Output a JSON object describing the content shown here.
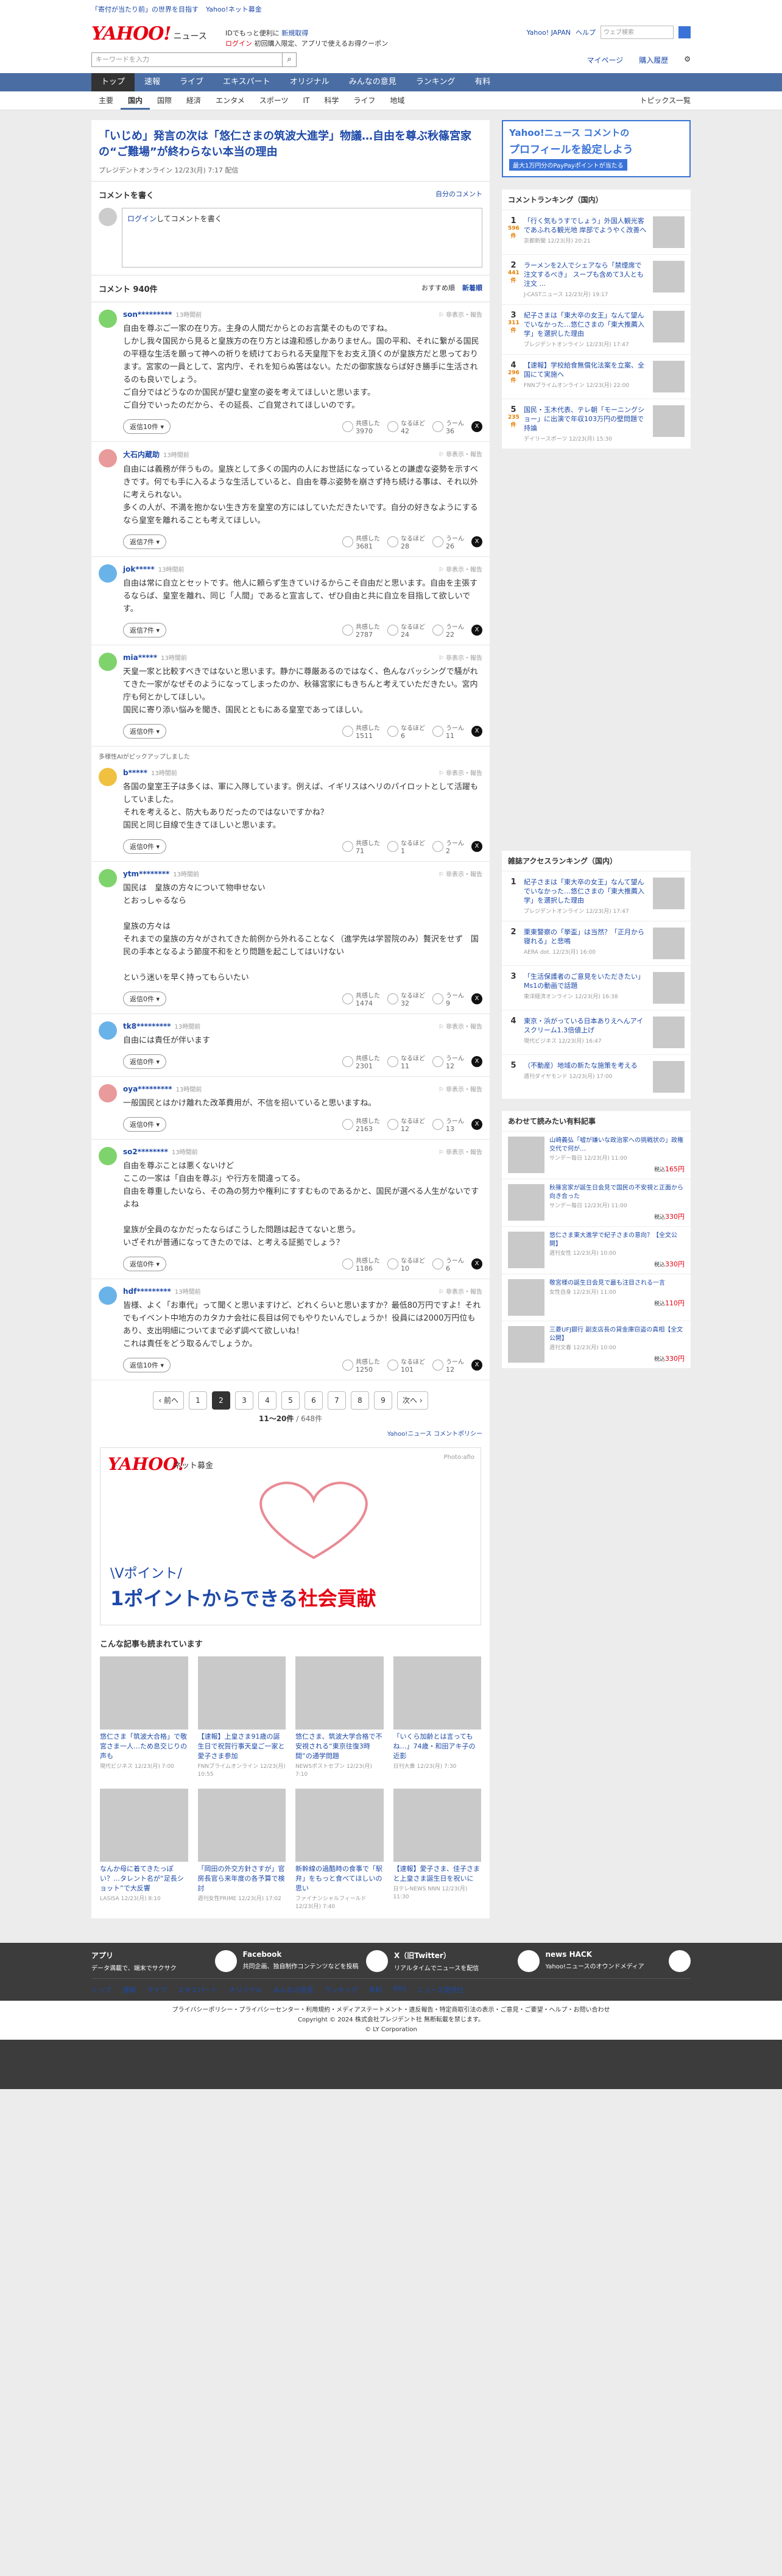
{
  "top_banner": [
    "「寄付が当たり前」の世界を目指す",
    "Yahoo!ネット募金"
  ],
  "header": {
    "logo": "YAHOO!",
    "logo_sub": "JAPAN",
    "title": "ニュース",
    "promo1": "IDでもっと便利に",
    "promo1_link": "新規取得",
    "promo2_link": "ログイン",
    "promo2": "初回購入限定、アプリで使えるお得クーポン",
    "links": [
      "Yahoo! JAPAN",
      "ヘルプ"
    ],
    "search_placeholder": "ウェブ検索",
    "search_btn": "検索",
    "news_search": "キーワードを入力",
    "mypage": "マイページ",
    "bought": "購入履歴"
  },
  "nav": [
    "トップ",
    "速報",
    "ライブ",
    "エキスパート",
    "オリジナル",
    "みんなの意見",
    "ランキング",
    "有料"
  ],
  "subnav": [
    "主要",
    "国内",
    "国際",
    "経済",
    "エンタメ",
    "スポーツ",
    "IT",
    "科学",
    "ライフ",
    "地域"
  ],
  "subnav_right": "トピックス一覧",
  "article": {
    "title": "「いじめ」発言の次は「悠仁さまの筑波大進学」物議…自由を尊ぶ秋篠宮家の“ご難場”が終わらない本当の理由",
    "meta": "プレジデントオンライン 12/23(月) 7:17 配信"
  },
  "comment_box": {
    "title": "コメントを書く",
    "link": "自分のコメント",
    "login": "ログイン",
    "placeholder": "してコメントを書く"
  },
  "comments_hd": {
    "title": "コメント 940件",
    "sort_recommend": "おすすめ順",
    "sort_new": "新着順"
  },
  "react_labels": [
    "共感した",
    "なるほど",
    "うーん"
  ],
  "reply": "返信",
  "report": "非表示・報告",
  "comments": [
    {
      "user": "son*********",
      "time": "13時間前",
      "text": "自由を尊ぶご一家の在り方。主身の人間だからとのお言葉そのものですね。\nしかし我々国民から見ると皇族方の在り方とは違和感しかありません。国の平和、それに繋がる国民の平穏な生活を願って神への祈りを続けておられる天皇陛下をお支え頂くのが皇族方だと思っております。宮家の一員として、宮内庁、それを知らぬ筈はない。ただの御家族ならば好き勝手に生活されるのも良いでしょう。\nご自分ではどうなのか国民が望む皇室の姿を考えてほしいと思います。\nご自分でいったのだから、その延長、ご自覚されてほしいのです。",
      "replies": "返信10件",
      "r": [
        3970,
        42,
        36
      ],
      "color": "#7fd36c"
    },
    {
      "user": "大石内蔵助",
      "time": "13時間前",
      "text": "自由には義務が伴うもの。皇族として多くの国内の人にお世話になっているとの謙虚な姿勢を示すべきです。何でも手に入るような生活していると、自由を尊ぶ姿勢を崩さず持ち続ける事は、それ以外に考えられない。\n多くの人が、不満を抱かない生き方を皇室の方にはしていただきたいです。自分の好きなようにするなら皇室を離れることも考えてほしい。",
      "replies": "返信7件",
      "r": [
        3681,
        28,
        26
      ],
      "color": "#e99a9a"
    },
    {
      "user": "jok*****",
      "time": "13時間前",
      "text": "自由は常に自立とセットです。他人に頼らず生きていけるからこそ自由だと思います。自由を主張するならば、皇室を離れ、同じ「人間」であると宣言して、ぜひ自由と共に自立を目指して欲しいです。",
      "replies": "返信7件",
      "r": [
        2787,
        24,
        22
      ],
      "color": "#6ab3e8"
    },
    {
      "user": "mia*****",
      "time": "13時間前",
      "text": "天皇一家と比較すべきではないと思います。静かに尊厳あるのではなく、色んなバッシングで騒がれてきた一家がなぜそのようになってしまったのか、秋篠宮家にもきちんと考えていただきたい。宮内庁も何とかしてほしい。\n国民に寄り添い悩みを聞き、国民とともにある皇室であってほしい。",
      "replies": "返信0件",
      "r": [
        1511,
        6,
        11
      ],
      "color": "#7fd36c"
    },
    {
      "pick": "多様性AIがピックアップしました",
      "user": "b*****",
      "time": "13時間前",
      "text": "各国の皇室王子は多くは、軍に入隊しています。例えば、イギリスはヘリのパイロットとして活躍もしていました。\nそれを考えると、防大もありだったのではないですかね？\n国民と同じ目線で生きてほしいと思います。",
      "replies": "返信0件",
      "r": [
        71,
        1,
        2
      ],
      "color": "#f0c040"
    },
    {
      "user": "ytm********",
      "time": "13時間前",
      "text": "国民は　皇族の方々について物申せない\nとおっしゃるなら\n\n皇族の方々は\nそれまでの皇族の方々がされてきた前例から外れることなく（進学先は学習院のみ）贅沢をせず　国民の手本となるよう節度不和をとり問題を起こしてはいけない\n\nという迷いを早く持ってもらいたい",
      "replies": "返信0件",
      "r": [
        1474,
        32,
        9
      ],
      "color": "#7fd36c"
    },
    {
      "user": "tk8*********",
      "time": "13時間前",
      "text": "自由には責任が伴います",
      "replies": "返信0件",
      "r": [
        2301,
        11,
        12
      ],
      "color": "#6ab3e8"
    },
    {
      "user": "oya*********",
      "time": "13時間前",
      "text": "一般国民とはかけ離れた改革費用が、不信を招いていると思いますね。",
      "replies": "返信0件",
      "r": [
        2163,
        12,
        13
      ],
      "color": "#e99a9a"
    },
    {
      "user": "so2********",
      "time": "13時間前",
      "text": "自由を尊ぶことは悪くないけど\nここの一家は「自由を尊ぶ」や行方を間違ってる。\n自由を尊重したいなら、その為の努力や権利にすすむものであるかと、国民が選べる人生がないですよね\n\n皇族が全員のなかだったならばこうした問題は起きてないと思う。\nいざそれが普通になってきたのでは、と考える証拠でしょう？",
      "replies": "返信0件",
      "r": [
        1186,
        10,
        6
      ],
      "color": "#7fd36c"
    },
    {
      "user": "hdf*********",
      "time": "13時間前",
      "text": "皆様、よく「お車代」って聞くと思いますけど、どれくらいと思いますか？最低80万円ですよ！それでもイベント中地方のカタカナ会社に長目は何でもやりたいんでしょうか！役員には2000万円位もあり、支出明細についてまで必ず調べて欲しいね！\nこれは責任をどう取るんでしょうか。",
      "replies": "返信10件",
      "r": [
        1250,
        101,
        12
      ],
      "color": "#6ab3e8"
    }
  ],
  "pager": {
    "prev": "前へ",
    "next": "次へ",
    "pages": [
      "1",
      "2",
      "3",
      "4",
      "5",
      "6",
      "7",
      "8",
      "9"
    ],
    "current": "2",
    "count": "11〜20件",
    "total": "648件"
  },
  "policy": "Yahoo!ニュース コメントポリシー",
  "ad": {
    "brand": "YAHOO!",
    "sub": "ネット募金",
    "credit": "Photo:afio",
    "line1": "\\Vポイント/",
    "line2a": "1ポイントからできる",
    "line2b": "社会貢献"
  },
  "related": {
    "title": "こんな記事も読まれています",
    "items": [
      {
        "t": "悠仁さま「筑波大合格」で敬宮さま一人…ため息交じりの声も",
        "s": "現代ビジネス 12/23(月) 7:00"
      },
      {
        "t": "【速報】上皇さま91歳の誕生日で祝賀行事天皇ご一家と愛子さま参加",
        "s": "FNNプライムオンライン 12/23(月) 10:55"
      },
      {
        "t": "悠仁さま、筑波大学合格で不安視される“東京往復3時間”の通学問題",
        "s": "NEWSポストセブン 12/23(月) 7:10"
      },
      {
        "t": "「いくら加齢とは言ってもね…」74歳・和田アキ子の近影",
        "s": "日刊大衆 12/23(月) 7:30"
      },
      {
        "t": "なんか母に着てきたっぽい？…タレント名が“足長ショット”で大反響",
        "s": "LASISA 12/23(月) 8:10"
      },
      {
        "t": "「岡田の外交方針さすが」官房長官ら来年度の各予算で検討",
        "s": "週刊女性PRIME 12/23(月) 17:02"
      },
      {
        "t": "新幹線の過酷時の食事で「駅弁」をもっと食べてほしいの思い",
        "s": "ファイナンシャルフィールド 12/23(月) 7:40"
      },
      {
        "t": "【速報】愛子さま、佳子さまと上皇さま誕生日を祝いに",
        "s": "日テレNEWS NNN 12/23(月) 11:30"
      }
    ]
  },
  "side": {
    "pr_l1": "Yahoo!ニュース コメントの",
    "pr_l2": "プロフィールを設定しよう",
    "pr_l3": "最大1万円分のPayPayポイントが当たる",
    "rank1_title": "コメントランキング（国内）",
    "rank1": [
      {
        "t": "「行く気もうすでしょう」外国人観光客であふれる観光地 岸部でようやく改善へ",
        "s": "京都新聞 12/23(月) 20:21",
        "c": "596件"
      },
      {
        "t": "ラーメンを2人でシェアなら「禁煙席で注文するべき」 スープも含めて3人とも注文 ...",
        "s": "J-CASTニュース 12/23(月) 19:17",
        "c": "441件"
      },
      {
        "t": "紀子さまは「東大卒の女王」なんて望んでいなかった…悠仁さまの「東大推薦入学」を選択した理由",
        "s": "プレジデントオンライン 12/23(月) 17:47",
        "c": "311件"
      },
      {
        "t": "【速報】学校給食無償化法案を立案、全国にて実施へ",
        "s": "FNNプライムオンライン 12/23(月) 22:00",
        "c": "296件"
      },
      {
        "t": "国民・玉木代表、テレ朝「モーニングショー」に出演で年収103万円の壁問題で持論",
        "s": "デイリースポーツ 12/23(月) 15:30",
        "c": "235件"
      }
    ],
    "rank2_title": "雑誌アクセスランキング（国内）",
    "rank2": [
      {
        "t": "紀子さまは「東大卒の女王」なんて望んでいなかった…悠仁さまの「東大推薦入学」を選択した理由",
        "s": "プレジデントオンライン 12/23(月) 17:47"
      },
      {
        "t": "栗東警察の「挙盃」は当然？「正月から寝れる」と悲鳴",
        "s": "AERA dot. 12/23(月) 16:00"
      },
      {
        "t": "「生活保護者のご意見をいただきたい」Ms1の動画で話題",
        "s": "東洋経済オンライン 12/23(月) 16:38"
      },
      {
        "t": "東京・浜がっている日本ありえへんアイスクリーム1.3倍値上げ",
        "s": "現代ビジネス 12/23(月) 16:47"
      },
      {
        "t": "（不動産）地域の新たな施策を考える",
        "s": "週刊ダイヤモンド 12/23(月) 17:00"
      }
    ],
    "shop_title": "あわせて読みたい有料記事",
    "shop": [
      {
        "t": "山崎義弘「嘘が嫌いな政治家への挑戦状の」政権交代で何が…",
        "s": "サンデー毎日 12/23(月) 11:00",
        "p": "165"
      },
      {
        "t": "秋篠宮家が誕生日会見で国民の不安視と正面から向き合った",
        "s": "サンデー毎日 12/23(月) 11:00",
        "p": "330"
      },
      {
        "t": "悠仁さま東大進学で紀子さまの意向？【全文公開】",
        "s": "週刊女性 12/23(月) 10:00",
        "p": "330"
      },
      {
        "t": "敬宮様の誕生日会見で最も注目される一言",
        "s": "女性自身 12/23(月) 11:00",
        "p": "110"
      },
      {
        "t": "三菱UFJ銀行 副支店長の貸金庫窃盗の真相【全文公開】",
        "s": "週刊文春 12/23(月) 10:00",
        "p": "330"
      }
    ]
  },
  "footer": {
    "cells": [
      {
        "b": "アプリ",
        "s": "データ満載で、端末でサクサク"
      },
      {
        "b": "Facebook",
        "s": "共同企画、独自制作コンテンツなどを投稿"
      },
      {
        "b": "X（旧Twitter）",
        "s": "リアルタイムでニュースを配信"
      },
      {
        "b": "news HACK",
        "s": "Yahoo!ニュースのオウンドメディア"
      }
    ],
    "links": [
      "トップ",
      "速報",
      "ライブ",
      "エキスパート",
      "オリジナル",
      "みんなの意見",
      "ランキング",
      "有料",
      "RSS",
      "ニュース提供社"
    ],
    "legal": "プライバシーポリシー・プライバシーセンター・利用規約・メディアステートメント・違反報告・特定商取引法の表示・ご意見・ご要望・ヘルプ・お問い合わせ",
    "copy": "Copyright © 2024 株式会社プレジデント社 無断転載を禁じます。",
    "corp": "© LY Corporation"
  }
}
